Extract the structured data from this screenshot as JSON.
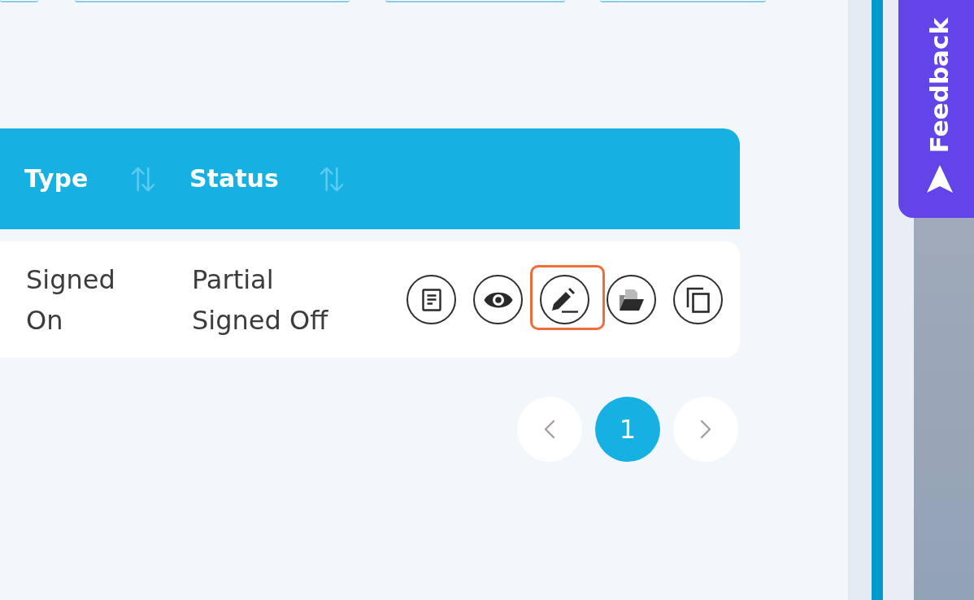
{
  "table": {
    "columns": [
      {
        "label": "Type",
        "sortable": true
      },
      {
        "label": "Status",
        "sortable": true
      }
    ],
    "rows": [
      {
        "cells": [
          "Signed On",
          "Partial Signed Off"
        ],
        "actions": [
          {
            "kind": "document",
            "highlighted": false
          },
          {
            "kind": "view",
            "highlighted": false
          },
          {
            "kind": "edit",
            "highlighted": true
          },
          {
            "kind": "folder",
            "highlighted": false
          },
          {
            "kind": "copy",
            "highlighted": false
          }
        ]
      }
    ]
  },
  "pagination": {
    "pages": [
      {
        "label": "1",
        "selected": true
      }
    ]
  },
  "feedback_tab": {
    "label": "Feedback"
  }
}
